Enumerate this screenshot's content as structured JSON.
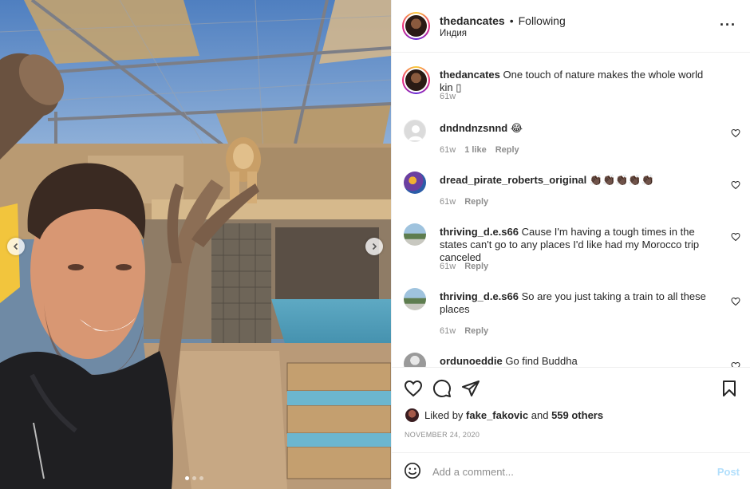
{
  "post": {
    "author": "thedancates",
    "follow_status": "Following",
    "separator": "•",
    "location": "Индия",
    "caption": "One touch of nature makes the whole world kin",
    "caption_time": "61w"
  },
  "comments": [
    {
      "user": "dndndnzsnnd",
      "text": "😂",
      "time": "61w",
      "likes": "1 like",
      "reply": "Reply",
      "avatar_color": "#dbdbdb"
    },
    {
      "user": "dread_pirate_roberts_original",
      "text": "👏🏿👏🏿👏🏿👏🏿👏🏿",
      "time": "61w",
      "reply": "Reply",
      "avatar_color": "#6b3fa0"
    },
    {
      "user": "thriving_d.e.s66",
      "text": "Cause I'm having a tough times in the states can't go to any places I'd like had my Morocco trip canceled",
      "time": "61w",
      "reply": "Reply",
      "avatar_color": "#9ab7c7"
    },
    {
      "user": "thriving_d.e.s66",
      "text": "So are you just taking a train to all these places",
      "time": "61w",
      "reply": "Reply",
      "avatar_color": "#9ab7c7"
    },
    {
      "user": "ordunoeddie",
      "text": "Go find Buddha",
      "avatar_color": "#bdbdbd"
    }
  ],
  "likes": {
    "prefix": "Liked by",
    "user": "fake_fakovic",
    "joiner": "and",
    "others": "559 others"
  },
  "date": "NOVEMBER 24, 2020",
  "add_comment": {
    "placeholder": "Add a comment...",
    "post_label": "Post"
  },
  "carousel": {
    "slide_count": 3,
    "active": 0
  },
  "icons": {
    "prev": "chevron-left-icon",
    "next": "chevron-right-icon",
    "more": "more-options-icon",
    "like": "heart-icon",
    "comment": "comment-icon",
    "share": "share-icon",
    "save": "bookmark-icon",
    "emoji": "emoji-icon"
  },
  "colors": {
    "text": "#262626",
    "muted": "#8e8e8e",
    "post_button_disabled": "#b2dffc",
    "border": "#efefef"
  }
}
